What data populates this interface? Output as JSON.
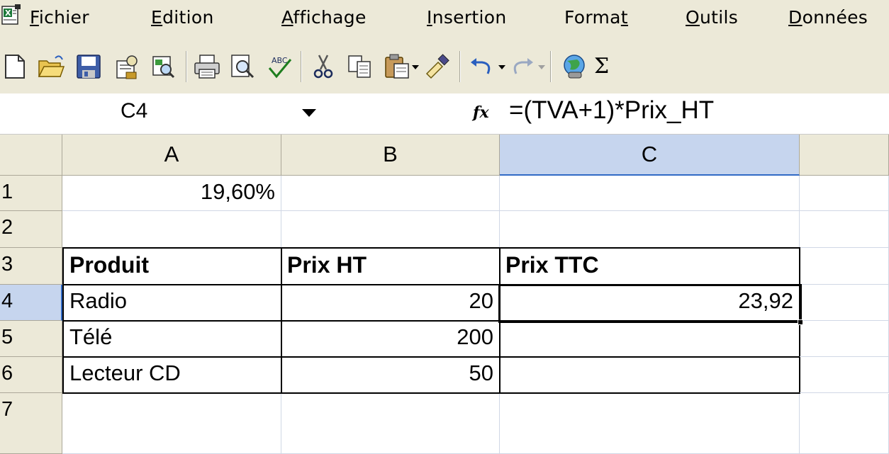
{
  "menu": {
    "items": [
      {
        "pre": "",
        "key": "F",
        "post": "ichier"
      },
      {
        "pre": "",
        "key": "E",
        "post": "dition"
      },
      {
        "pre": "",
        "key": "A",
        "post": "ffichage"
      },
      {
        "pre": "",
        "key": "I",
        "post": "nsertion"
      },
      {
        "pre": "Forma",
        "key": "t",
        "post": ""
      },
      {
        "pre": "",
        "key": "O",
        "post": "utils"
      },
      {
        "pre": "",
        "key": "D",
        "post": "onnées"
      }
    ]
  },
  "toolbar": {
    "icons": [
      "new-document-icon",
      "open-folder-icon",
      "save-icon",
      "permission-icon",
      "search-icon",
      "print-icon",
      "print-preview-icon",
      "spelling-icon",
      "cut-icon",
      "copy-icon",
      "paste-icon",
      "format-painter-icon",
      "undo-icon",
      "redo-icon",
      "hyperlink-icon",
      "autosum-icon"
    ],
    "autosum_glyph": "Σ"
  },
  "formula_bar": {
    "name_box": "C4",
    "fx_label": "fx",
    "formula": "=(TVA+1)*Prix_HT"
  },
  "sheet": {
    "columns": [
      "A",
      "B",
      "C"
    ],
    "rows": [
      "1",
      "2",
      "3",
      "4",
      "5",
      "6",
      "7"
    ],
    "active_cell": "C4",
    "cells": {
      "A1": "19,60%",
      "A3": "Produit",
      "B3": "Prix HT",
      "C3": "Prix TTC",
      "A4": "Radio",
      "B4": "20",
      "C4": "23,92",
      "A5": "Télé",
      "B5": "200",
      "A6": "Lecteur CD",
      "B6": "50"
    }
  }
}
